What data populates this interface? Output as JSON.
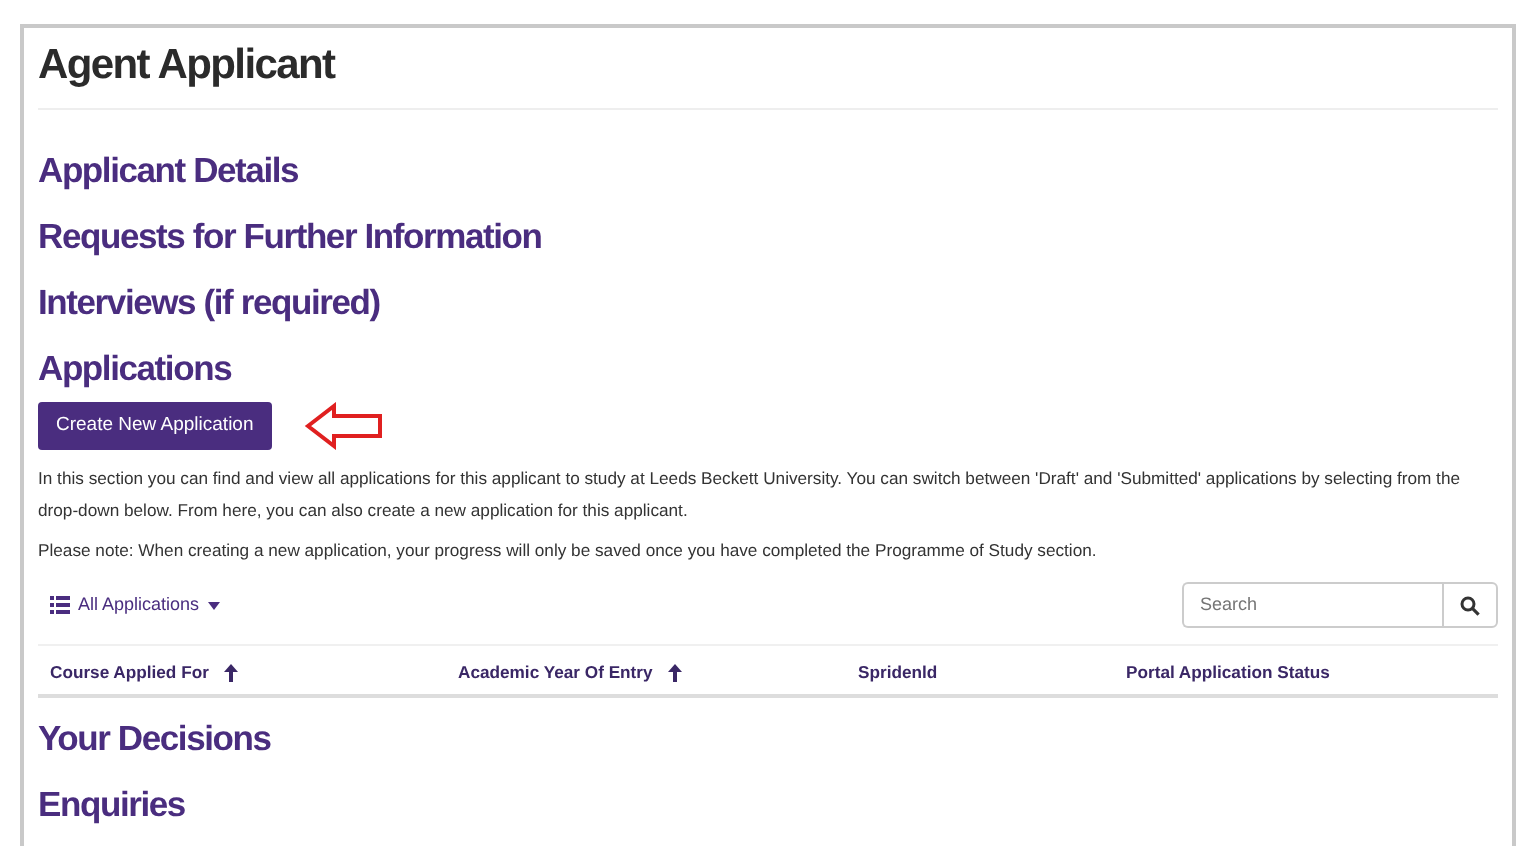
{
  "title": "Agent Applicant",
  "sections_before": [
    "Applicant Details",
    "Requests for Further Information",
    "Interviews (if required)"
  ],
  "applications": {
    "heading": "Applications",
    "button": "Create New Application",
    "paragraphs": [
      "In this section you can find and view all applications for this applicant to study at Leeds Beckett University. You can switch between 'Draft' and 'Submitted' applications by selecting from the drop-down below. From here, you can also create a new application for this applicant.",
      "Please note: When creating a new application, your progress will only be saved once you have completed the Programme of Study section."
    ],
    "filter": "All Applications",
    "search": {
      "placeholder": "Search"
    },
    "columns": [
      {
        "label": "Course Applied For",
        "sortable": true
      },
      {
        "label": "Academic Year Of Entry",
        "sortable": true
      },
      {
        "label": "Spridenld",
        "sortable": false
      },
      {
        "label": "Portal Application Status",
        "sortable": false
      }
    ]
  },
  "sections_after": [
    "Your Decisions",
    "Enquiries"
  ]
}
